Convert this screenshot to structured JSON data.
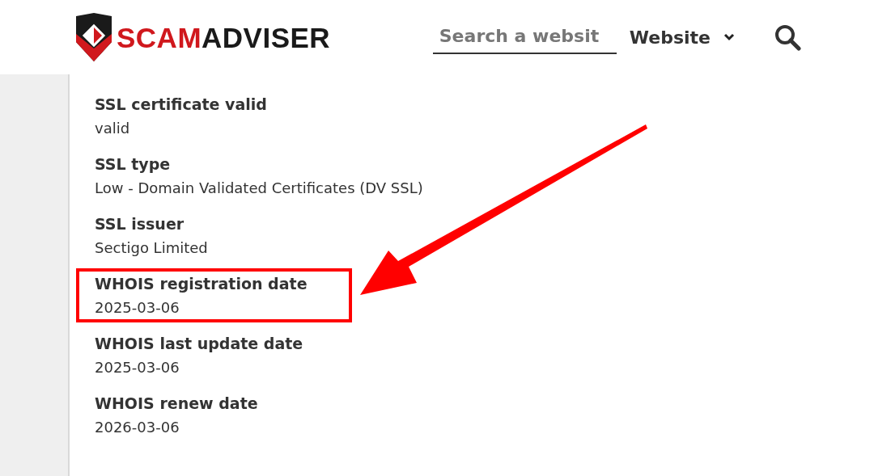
{
  "header": {
    "logo": {
      "part_1": "SCAM",
      "part_2": "ADVISER"
    },
    "search": {
      "placeholder": "Search a websit"
    },
    "dropdown": {
      "label": "Website"
    }
  },
  "details": [
    {
      "label": "SSL certificate valid",
      "value": "valid",
      "highlighted": false
    },
    {
      "label": "SSL type",
      "value": "Low - Domain Validated Certificates (DV SSL)",
      "highlighted": false
    },
    {
      "label": "SSL issuer",
      "value": "Sectigo Limited",
      "highlighted": false
    },
    {
      "label": "WHOIS registration date",
      "value": "2025-03-06",
      "highlighted": true
    },
    {
      "label": "WHOIS last update date",
      "value": "2025-03-06",
      "highlighted": false
    },
    {
      "label": "WHOIS renew date",
      "value": "2026-03-06",
      "highlighted": false
    }
  ],
  "annotation": {
    "kind": "arrow"
  }
}
